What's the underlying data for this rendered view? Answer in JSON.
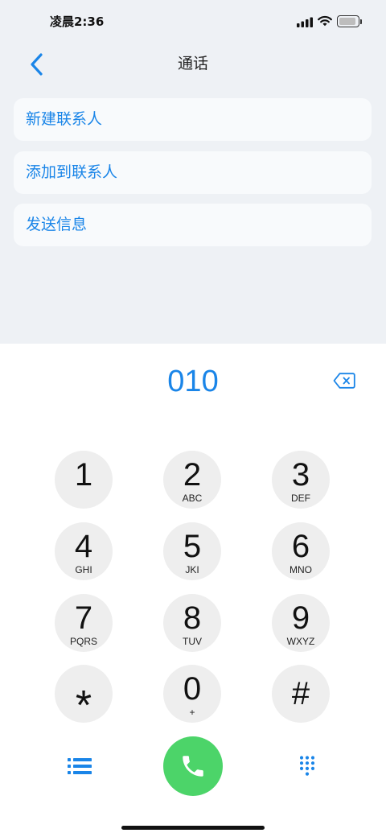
{
  "status_bar": {
    "time": "凌晨2:36",
    "signal_icon": "signal-icon",
    "signal_bars_lit": 4,
    "wifi_icon": "wifi-icon",
    "battery_icon": "battery-icon",
    "battery_level": 0.9
  },
  "header": {
    "back_icon": "chevron-left-icon",
    "title": "通话"
  },
  "actions": [
    {
      "label": "新建联系人"
    },
    {
      "label": "添加到联系人"
    },
    {
      "label": "发送信息"
    }
  ],
  "dialer": {
    "number": "010",
    "backspace_icon": "backspace-icon"
  },
  "keypad": [
    {
      "digit": "1"
    },
    {
      "digit": "2",
      "letters": "ABC"
    },
    {
      "digit": "3",
      "letters": "DEF"
    },
    {
      "digit": "4",
      "letters": "GHI"
    },
    {
      "digit": "5",
      "letters": "JKI"
    },
    {
      "digit": "6",
      "letters": "MNO"
    },
    {
      "digit": "7",
      "letters": "PQRS"
    },
    {
      "digit": "8",
      "letters": "TUV"
    },
    {
      "digit": "9",
      "letters": "WXYZ"
    },
    {
      "digit": "*"
    },
    {
      "digit": "0",
      "letters": "+"
    },
    {
      "digit": "#"
    }
  ],
  "bottom_bar": {
    "left_icon": "list-icon",
    "call_icon": "phone-icon",
    "right_icon": "dialpad-icon"
  },
  "colors": {
    "accent": "#1a85e8",
    "call": "#4cd469",
    "top_background": "#eef1f5",
    "card": "#f8fafc",
    "key": "#eeeeee"
  }
}
